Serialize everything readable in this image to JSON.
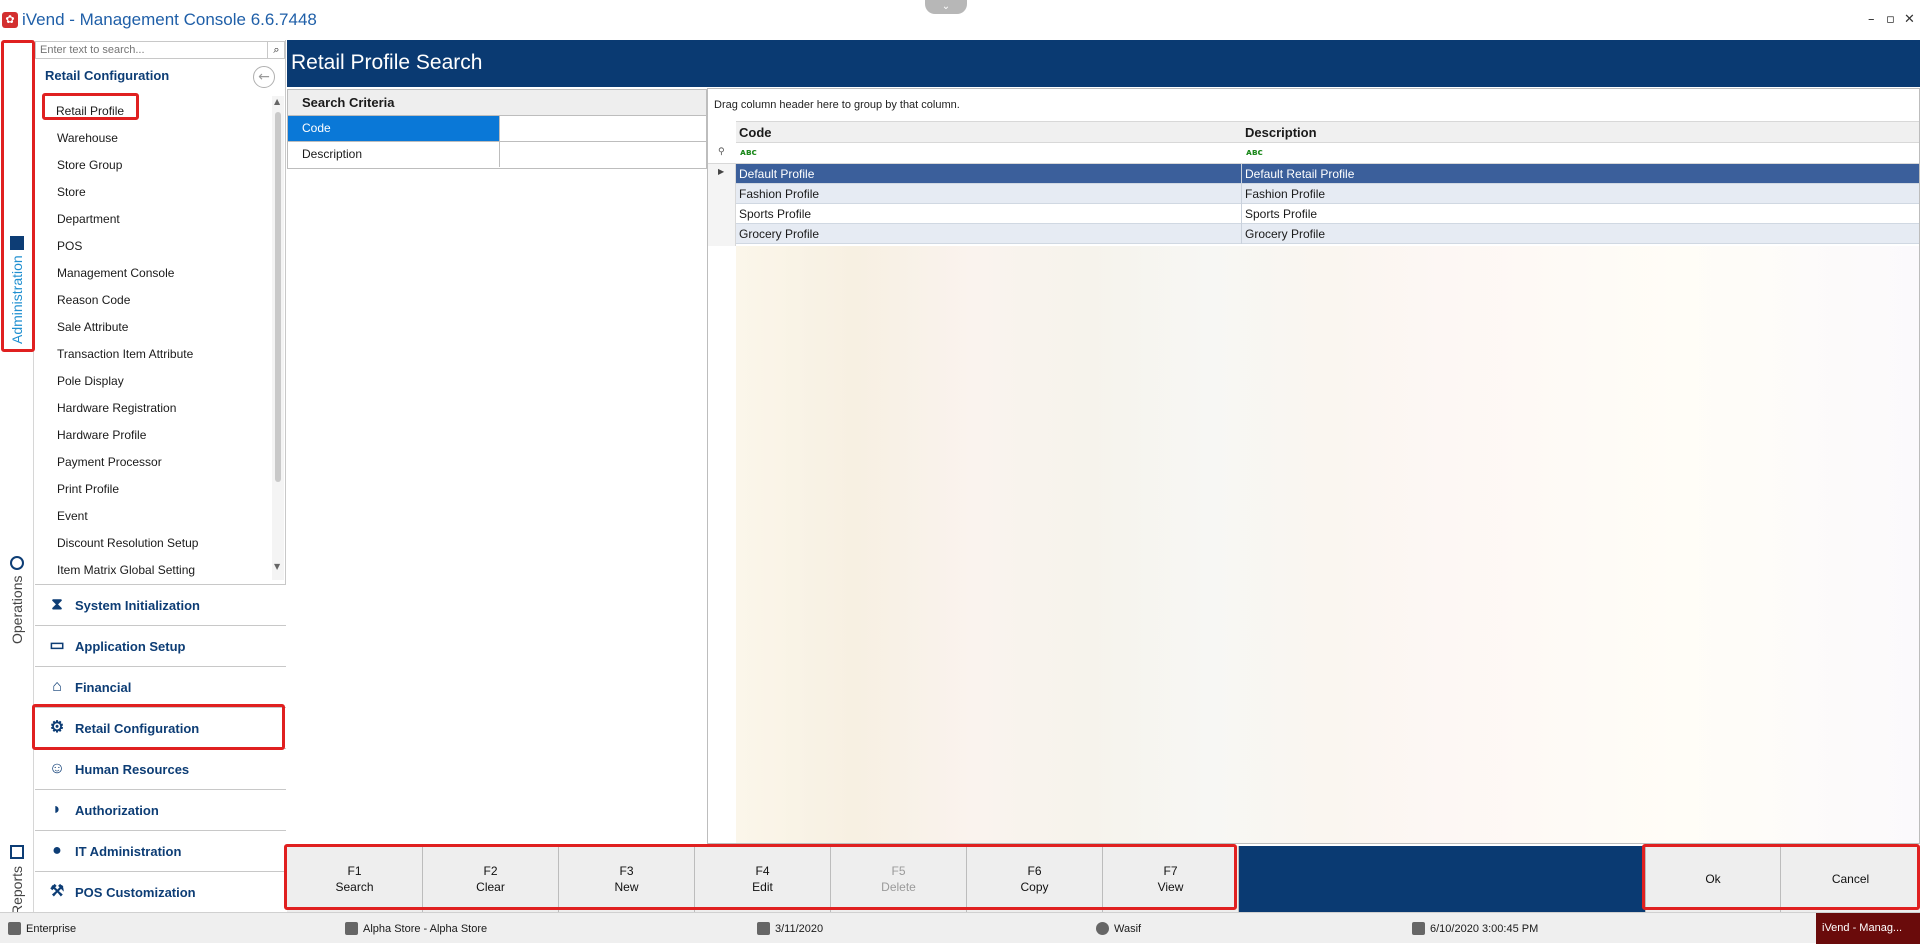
{
  "app": {
    "title": "iVend - Management Console  6.6.7448",
    "window_controls": [
      "–",
      "▫",
      "✕"
    ]
  },
  "side_tabs": {
    "administration": "Administration",
    "operations": "Operations",
    "reports": "Reports"
  },
  "nav": {
    "search_placeholder": "Enter text to search...",
    "header": "Retail Configuration",
    "items": [
      "Retail Profile",
      "Warehouse",
      "Store Group",
      "Store",
      "Department",
      "POS",
      "Management Console",
      "Reason Code",
      "Sale Attribute",
      "Transaction Item Attribute",
      "Pole Display",
      "Hardware Registration",
      "Hardware Profile",
      "Payment Processor",
      "Print Profile",
      "Event",
      "Discount Resolution Setup",
      "Item Matrix Global Setting"
    ],
    "sections": [
      {
        "label": "System Initialization",
        "icon": "hourglass-icon"
      },
      {
        "label": "Application Setup",
        "icon": "window-icon"
      },
      {
        "label": "Financial",
        "icon": "bank-icon"
      },
      {
        "label": "Retail Configuration",
        "icon": "gears-icon"
      },
      {
        "label": "Human Resources",
        "icon": "people-icon"
      },
      {
        "label": "Authorization",
        "icon": "shield-icon"
      },
      {
        "label": "IT Administration",
        "icon": "admin-user-icon"
      },
      {
        "label": "POS Customization",
        "icon": "pos-icon"
      }
    ]
  },
  "main": {
    "title": "Retail Profile Search",
    "criteria": {
      "header": "Search Criteria",
      "fields": [
        {
          "label": "Code",
          "value": ""
        },
        {
          "label": "Description",
          "value": ""
        }
      ]
    },
    "grid": {
      "group_hint": "Drag column header here to group by that column.",
      "columns": [
        "Code",
        "Description"
      ],
      "filter_glyph": "ᴀʙc",
      "rows": [
        {
          "code": "Default Profile",
          "description": "Default Retail Profile"
        },
        {
          "code": "Fashion Profile",
          "description": "Fashion Profile"
        },
        {
          "code": "Sports Profile",
          "description": "Sports Profile"
        },
        {
          "code": "Grocery Profile",
          "description": "Grocery Profile"
        }
      ]
    }
  },
  "function_buttons": [
    {
      "key": "F1",
      "label": "Search",
      "enabled": true
    },
    {
      "key": "F2",
      "label": "Clear",
      "enabled": true
    },
    {
      "key": "F3",
      "label": "New",
      "enabled": true
    },
    {
      "key": "F4",
      "label": "Edit",
      "enabled": true
    },
    {
      "key": "F5",
      "label": "Delete",
      "enabled": false
    },
    {
      "key": "F6",
      "label": "Copy",
      "enabled": true
    },
    {
      "key": "F7",
      "label": "View",
      "enabled": true
    }
  ],
  "dialog_buttons": {
    "ok": "Ok",
    "cancel": "Cancel"
  },
  "status": {
    "edition": "Enterprise",
    "store": "Alpha Store - Alpha Store",
    "business_date": "3/11/2020",
    "user": "Wasif",
    "datetime": "6/10/2020 3:00:45 PM",
    "taskbar": "iVend - Manag..."
  },
  "colors": {
    "header_blue": "#0a3a72",
    "highlight_red": "#e02020",
    "selection_blue": "#0a78d7"
  }
}
